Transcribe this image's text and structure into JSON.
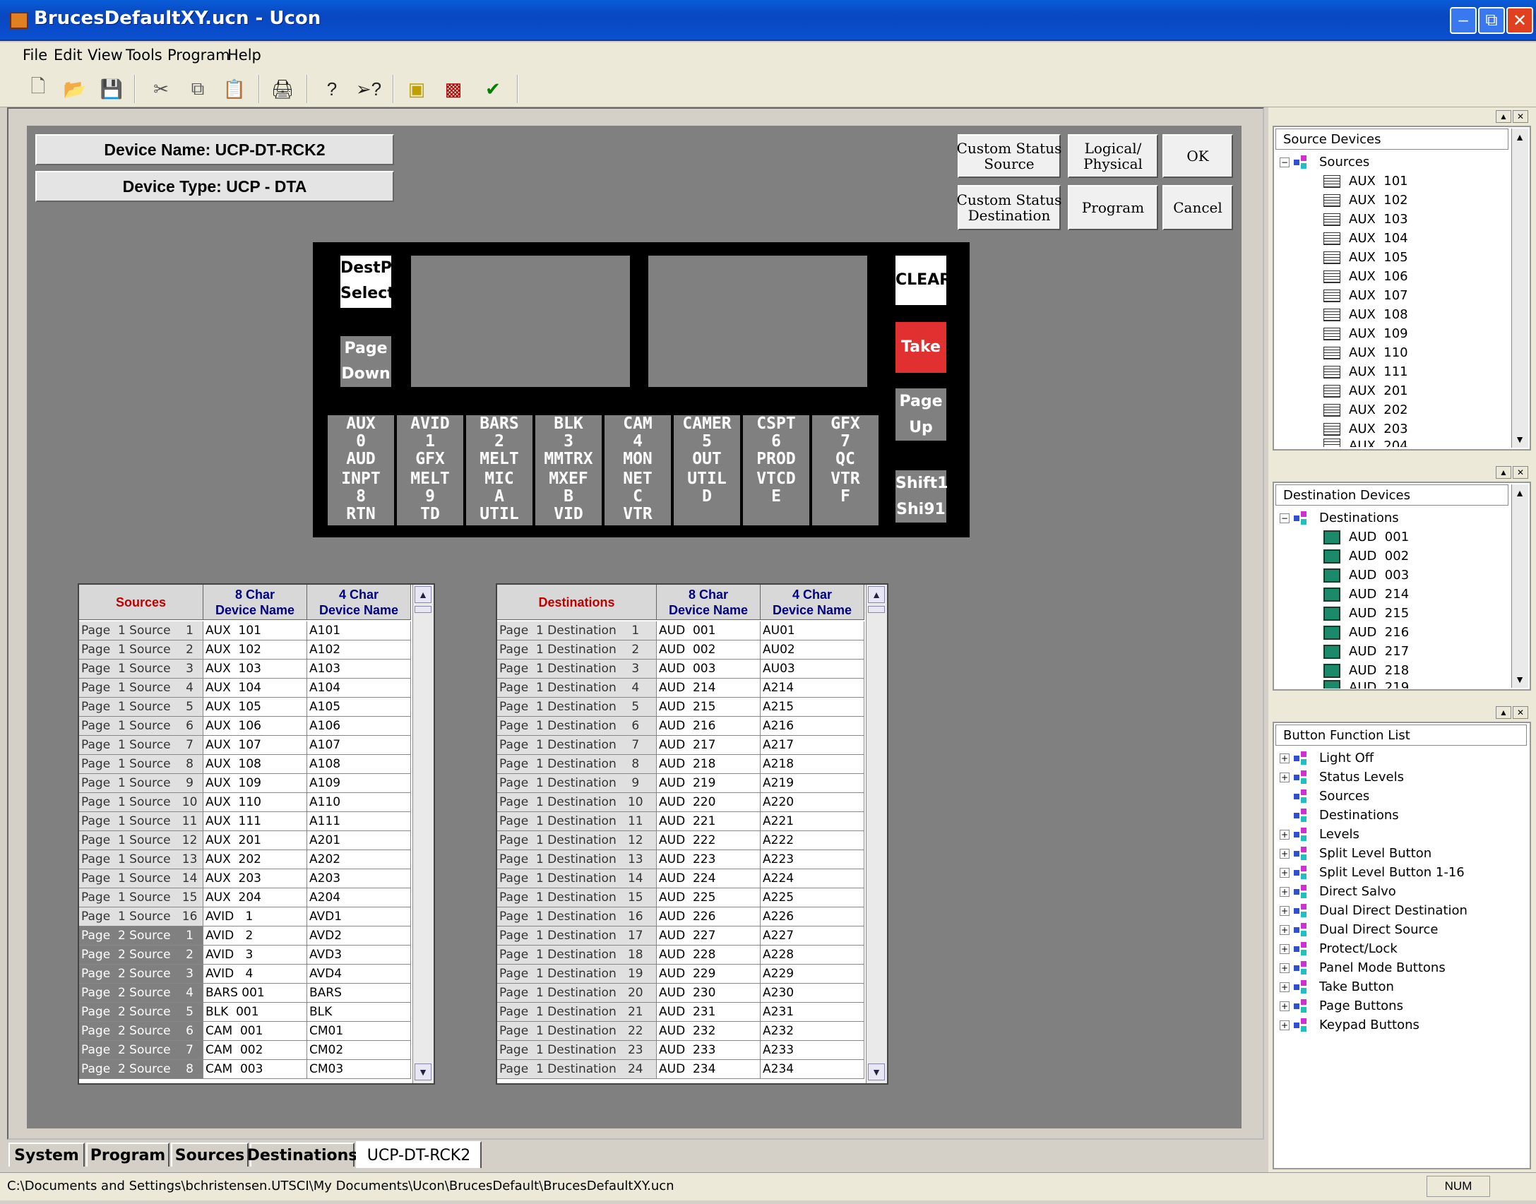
{
  "window": {
    "title": "BrucesDefaultXY.ucn - Ucon"
  },
  "menu": [
    "File",
    "Edit",
    "View",
    "Tools",
    "Program",
    "Help"
  ],
  "device": {
    "name": "Device Name: UCP-DT-RCK2",
    "type": "Device Type: UCP - DTA"
  },
  "buttons": {
    "custom_status_source": "Custom Status\nSource",
    "logical_physical": "Logical/\nPhysical",
    "ok": "OK",
    "custom_status_destination": "Custom Status\nDestination",
    "program": "Program",
    "cancel": "Cancel"
  },
  "panel": {
    "dest_select": "DestP\nSelect",
    "page_down": "Page\nDown",
    "clear": "CLEAR",
    "take": "Take",
    "page_up": "Page\nUp",
    "shift": "Shift1\nShi91",
    "keys_top": [
      "AUX\n0\nAUD",
      "AVID\n1\nGFX",
      "BARS\n2\nMELT",
      "BLK\n3\nMMTRX",
      "CAM\n4\nMON",
      "CAMER\n5\nOUT",
      "CSPT\n6\nPROD",
      "GFX\n7\nQC"
    ],
    "keys_bottom": [
      "INPT\n8\nRTN",
      "MELT\n9\nTD",
      "MIC\nA\nUTIL",
      "MXEF\nB\nVID",
      "NET\nC\nVTR",
      "UTIL\nD\n ",
      "VTCD\nE\n ",
      "VTR\nF\n "
    ]
  },
  "sources_table": {
    "headers": [
      "Sources",
      "8 Char\nDevice Name",
      "4 Char\nDevice Name"
    ],
    "rows": [
      [
        "Page  1 Source    1",
        "AUX  101",
        "A101"
      ],
      [
        "Page  1 Source    2",
        "AUX  102",
        "A102"
      ],
      [
        "Page  1 Source    3",
        "AUX  103",
        "A103"
      ],
      [
        "Page  1 Source    4",
        "AUX  104",
        "A104"
      ],
      [
        "Page  1 Source    5",
        "AUX  105",
        "A105"
      ],
      [
        "Page  1 Source    6",
        "AUX  106",
        "A106"
      ],
      [
        "Page  1 Source    7",
        "AUX  107",
        "A107"
      ],
      [
        "Page  1 Source    8",
        "AUX  108",
        "A108"
      ],
      [
        "Page  1 Source    9",
        "AUX  109",
        "A109"
      ],
      [
        "Page  1 Source   10",
        "AUX  110",
        "A110"
      ],
      [
        "Page  1 Source   11",
        "AUX  111",
        "A111"
      ],
      [
        "Page  1 Source   12",
        "AUX  201",
        "A201"
      ],
      [
        "Page  1 Source   13",
        "AUX  202",
        "A202"
      ],
      [
        "Page  1 Source   14",
        "AUX  203",
        "A203"
      ],
      [
        "Page  1 Source   15",
        "AUX  204",
        "A204"
      ],
      [
        "Page  1 Source   16",
        "AVID   1",
        "AVD1"
      ],
      [
        "Page  2 Source    1",
        "AVID   2",
        "AVD2"
      ],
      [
        "Page  2 Source    2",
        "AVID   3",
        "AVD3"
      ],
      [
        "Page  2 Source    3",
        "AVID   4",
        "AVD4"
      ],
      [
        "Page  2 Source    4",
        "BARS 001",
        "BARS"
      ],
      [
        "Page  2 Source    5",
        "BLK  001",
        "BLK"
      ],
      [
        "Page  2 Source    6",
        "CAM  001",
        "CM01"
      ],
      [
        "Page  2 Source    7",
        "CAM  002",
        "CM02"
      ],
      [
        "Page  2 Source    8",
        "CAM  003",
        "CM03"
      ]
    ]
  },
  "destinations_table": {
    "headers": [
      "Destinations",
      "8 Char\nDevice Name",
      "4 Char\nDevice Name"
    ],
    "rows": [
      [
        "Page  1 Destination    1",
        "AUD  001",
        "AU01"
      ],
      [
        "Page  1 Destination    2",
        "AUD  002",
        "AU02"
      ],
      [
        "Page  1 Destination    3",
        "AUD  003",
        "AU03"
      ],
      [
        "Page  1 Destination    4",
        "AUD  214",
        "A214"
      ],
      [
        "Page  1 Destination    5",
        "AUD  215",
        "A215"
      ],
      [
        "Page  1 Destination    6",
        "AUD  216",
        "A216"
      ],
      [
        "Page  1 Destination    7",
        "AUD  217",
        "A217"
      ],
      [
        "Page  1 Destination    8",
        "AUD  218",
        "A218"
      ],
      [
        "Page  1 Destination    9",
        "AUD  219",
        "A219"
      ],
      [
        "Page  1 Destination   10",
        "AUD  220",
        "A220"
      ],
      [
        "Page  1 Destination   11",
        "AUD  221",
        "A221"
      ],
      [
        "Page  1 Destination   12",
        "AUD  222",
        "A222"
      ],
      [
        "Page  1 Destination   13",
        "AUD  223",
        "A223"
      ],
      [
        "Page  1 Destination   14",
        "AUD  224",
        "A224"
      ],
      [
        "Page  1 Destination   15",
        "AUD  225",
        "A225"
      ],
      [
        "Page  1 Destination   16",
        "AUD  226",
        "A226"
      ],
      [
        "Page  1 Destination   17",
        "AUD  227",
        "A227"
      ],
      [
        "Page  1 Destination   18",
        "AUD  228",
        "A228"
      ],
      [
        "Page  1 Destination   19",
        "AUD  229",
        "A229"
      ],
      [
        "Page  1 Destination   20",
        "AUD  230",
        "A230"
      ],
      [
        "Page  1 Destination   21",
        "AUD  231",
        "A231"
      ],
      [
        "Page  1 Destination   22",
        "AUD  232",
        "A232"
      ],
      [
        "Page  1 Destination   23",
        "AUD  233",
        "A233"
      ],
      [
        "Page  1 Destination   24",
        "AUD  234",
        "A234"
      ]
    ]
  },
  "tabs": [
    "System",
    "Program",
    "Sources",
    "Destinations",
    "UCP-DT-RCK2"
  ],
  "status": {
    "path": "C:\\Documents and Settings\\bchristensen.UTSCI\\My Documents\\Ucon\\BrucesDefault\\BrucesDefaultXY.ucn",
    "num": "NUM"
  },
  "source_devices": {
    "title": "Source Devices",
    "root": "Sources",
    "items": [
      "AUX  101",
      "AUX  102",
      "AUX  103",
      "AUX  104",
      "AUX  105",
      "AUX  106",
      "AUX  107",
      "AUX  108",
      "AUX  109",
      "AUX  110",
      "AUX  111",
      "AUX  201",
      "AUX  202",
      "AUX  203"
    ],
    "partial": "AUX  204"
  },
  "destination_devices": {
    "title": "Destination Devices",
    "root": "Destinations",
    "items": [
      "AUD  001",
      "AUD  002",
      "AUD  003",
      "AUD  214",
      "AUD  215",
      "AUD  216",
      "AUD  217",
      "AUD  218"
    ],
    "partial": "AUD  219"
  },
  "button_function_list": {
    "title": "Button Function List",
    "items": [
      "Light Off",
      "Status Levels",
      "Sources",
      "Destinations",
      "Levels",
      "Split Level Button",
      "Split Level Button 1-16",
      "Direct Salvo",
      "Dual Direct Destination",
      "Dual Direct Source",
      "Protect/Lock",
      "Panel Mode Buttons",
      "Take Button",
      "Page Buttons",
      "Keypad Buttons"
    ],
    "expandable": [
      true,
      true,
      false,
      false,
      true,
      true,
      true,
      true,
      true,
      true,
      true,
      true,
      true,
      true,
      true
    ]
  },
  "colors": {
    "take": "#e03030",
    "title_blue": "#0a50d0",
    "header_navy": "#000080",
    "header_red": "#c00000"
  }
}
